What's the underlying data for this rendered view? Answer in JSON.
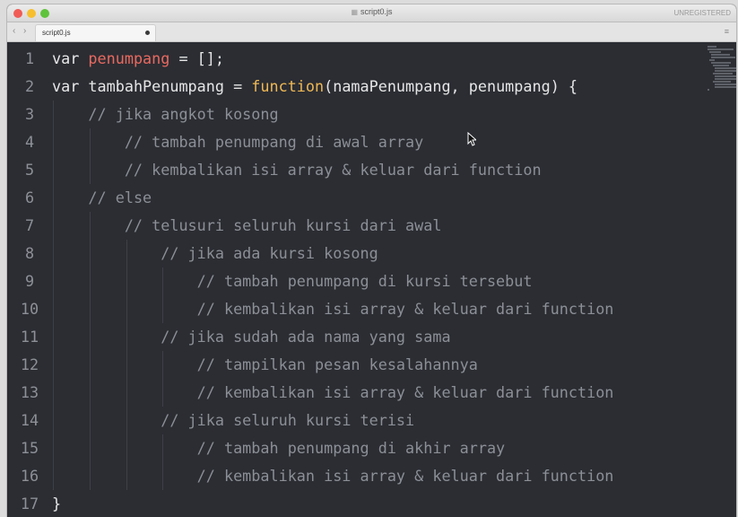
{
  "window": {
    "title": "script0.js",
    "status": "UNREGISTERED"
  },
  "tabbar": {
    "back_icon": "chevron-left-icon",
    "forward_icon": "chevron-right-icon",
    "tab_label": "script0.js",
    "menu_icon": "menu-icon"
  },
  "colors": {
    "background": "#2b2d33",
    "variable": "#e9695f",
    "function": "#efb855",
    "comment": "#8c8f96",
    "keyword": "#e8e8e8"
  },
  "code": {
    "lines": [
      {
        "n": "1",
        "indent": 0,
        "tokens": [
          [
            "kw",
            "var "
          ],
          [
            "var",
            "penumpang"
          ],
          [
            "op",
            " = [];"
          ]
        ]
      },
      {
        "n": "2",
        "indent": 0,
        "tokens": [
          [
            "kw",
            "var "
          ],
          [
            "op",
            "tambahPenumpang = "
          ],
          [
            "fn",
            "function"
          ],
          [
            "op",
            "(namaPenumpang, penumpang) {"
          ]
        ]
      },
      {
        "n": "3",
        "indent": 1,
        "tokens": [
          [
            "cm",
            "// jika angkot kosong"
          ]
        ]
      },
      {
        "n": "4",
        "indent": 2,
        "tokens": [
          [
            "cm",
            "// tambah penumpang di awal array"
          ]
        ]
      },
      {
        "n": "5",
        "indent": 2,
        "tokens": [
          [
            "cm",
            "// kembalikan isi array & keluar dari function"
          ]
        ]
      },
      {
        "n": "6",
        "indent": 1,
        "tokens": [
          [
            "cm",
            "// else"
          ]
        ]
      },
      {
        "n": "7",
        "indent": 2,
        "tokens": [
          [
            "cm",
            "// telusuri seluruh kursi dari awal"
          ]
        ]
      },
      {
        "n": "8",
        "indent": 3,
        "tokens": [
          [
            "cm",
            "// jika ada kursi kosong"
          ]
        ]
      },
      {
        "n": "9",
        "indent": 4,
        "tokens": [
          [
            "cm",
            "// tambah penumpang di kursi tersebut"
          ]
        ]
      },
      {
        "n": "10",
        "indent": 4,
        "tokens": [
          [
            "cm",
            "// kembalikan isi array & keluar dari function"
          ]
        ]
      },
      {
        "n": "11",
        "indent": 3,
        "tokens": [
          [
            "cm",
            "// jika sudah ada nama yang sama"
          ]
        ]
      },
      {
        "n": "12",
        "indent": 4,
        "tokens": [
          [
            "cm",
            "// tampilkan pesan kesalahannya"
          ]
        ]
      },
      {
        "n": "13",
        "indent": 4,
        "tokens": [
          [
            "cm",
            "// kembalikan isi array & keluar dari function"
          ]
        ]
      },
      {
        "n": "14",
        "indent": 3,
        "tokens": [
          [
            "cm",
            "// jika seluruh kursi terisi"
          ]
        ]
      },
      {
        "n": "15",
        "indent": 4,
        "tokens": [
          [
            "cm",
            "// tambah penumpang di akhir array"
          ]
        ]
      },
      {
        "n": "16",
        "indent": 4,
        "tokens": [
          [
            "cm",
            "// kembalikan isi array & keluar dari function"
          ]
        ]
      },
      {
        "n": "17",
        "indent": 0,
        "tokens": [
          [
            "op",
            "}"
          ]
        ]
      }
    ]
  }
}
